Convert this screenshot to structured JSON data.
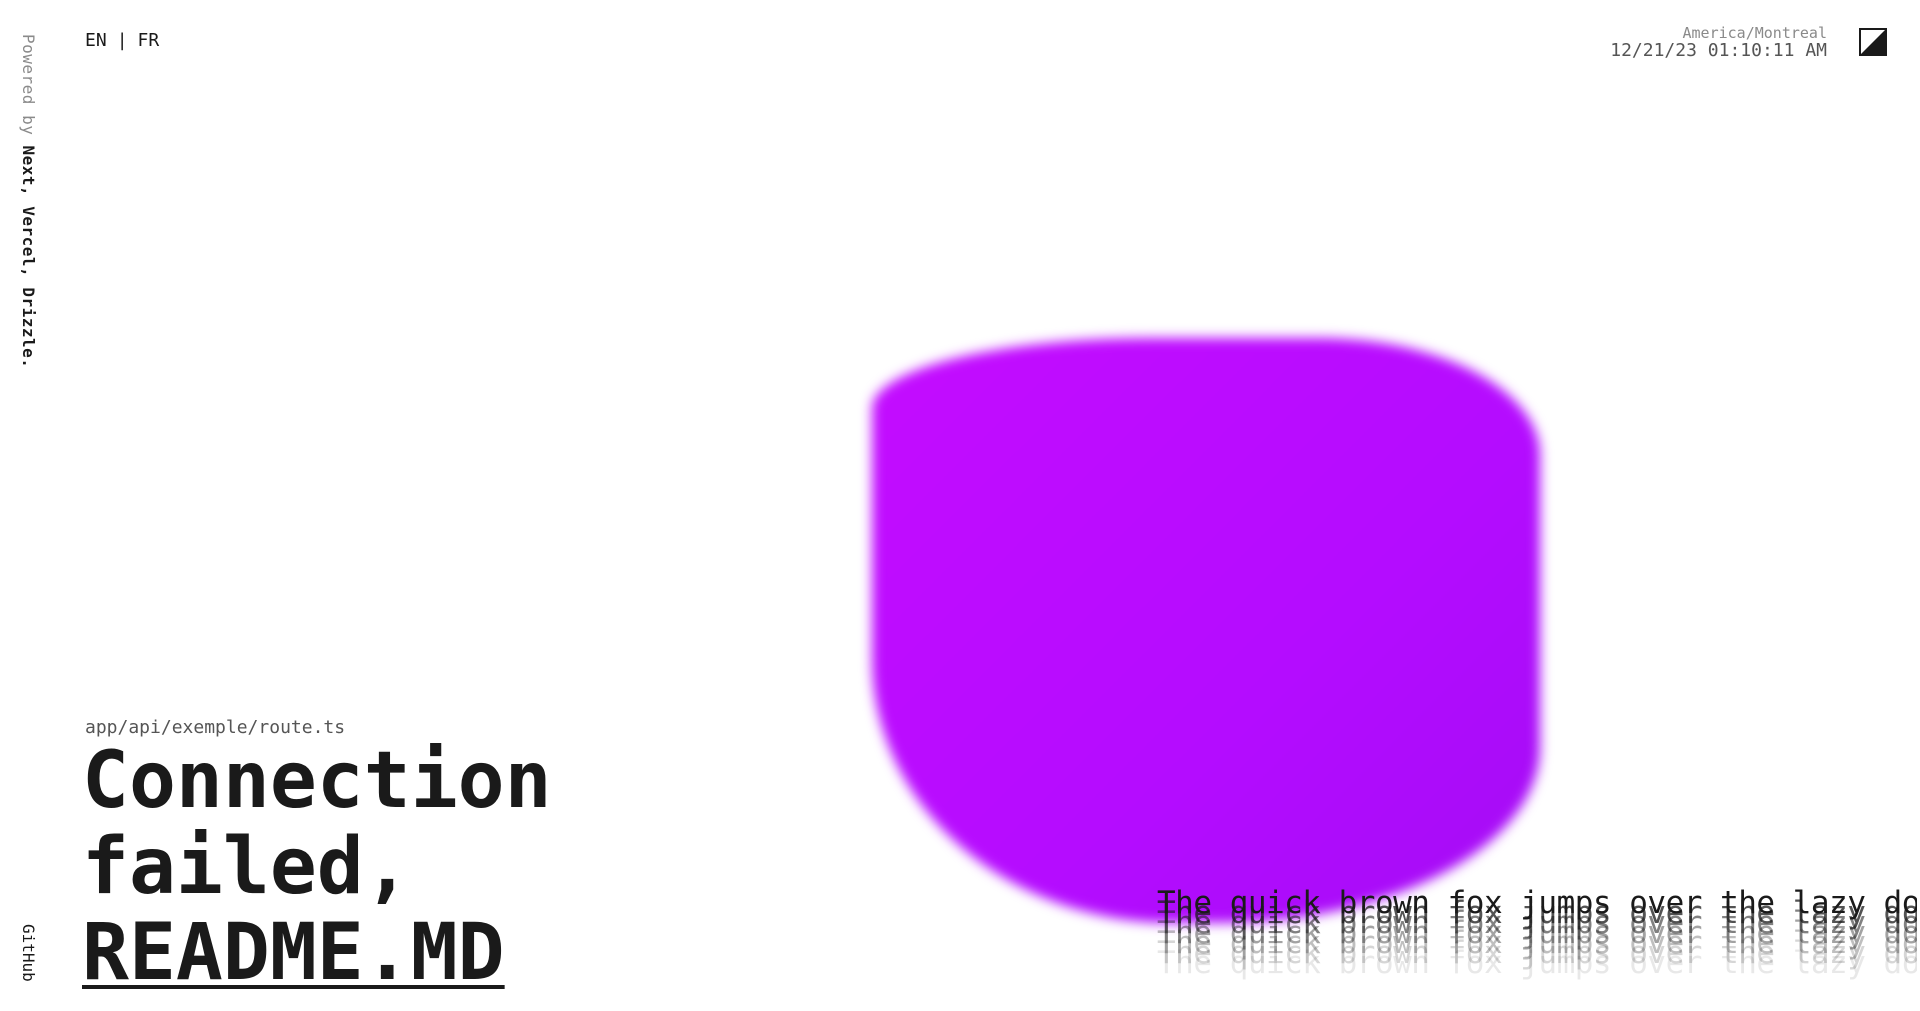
{
  "sidebar": {
    "powered_prefix": "Powered by ",
    "powered_tech": "Next, Vercel, Drizzle.",
    "github_label": "GitHub"
  },
  "header": {
    "lang_en": "EN",
    "lang_separator": "|",
    "lang_fr": "FR",
    "timezone": "America/Montreal",
    "datetime": "12/21/23 01:10:11 AM",
    "theme_toggle_icon": "contrast-icon"
  },
  "hero": {
    "route_path": "app/api/exemple/route.ts",
    "line1": "Connection",
    "line2": "failed,",
    "link_text": "README.MD"
  },
  "echo": {
    "sentence": "The quick brown fox jumps over the lazy dog."
  },
  "colors": {
    "blob_accent": "#b80cff",
    "text": "#1a1a1a",
    "muted": "#8a8a8a"
  }
}
